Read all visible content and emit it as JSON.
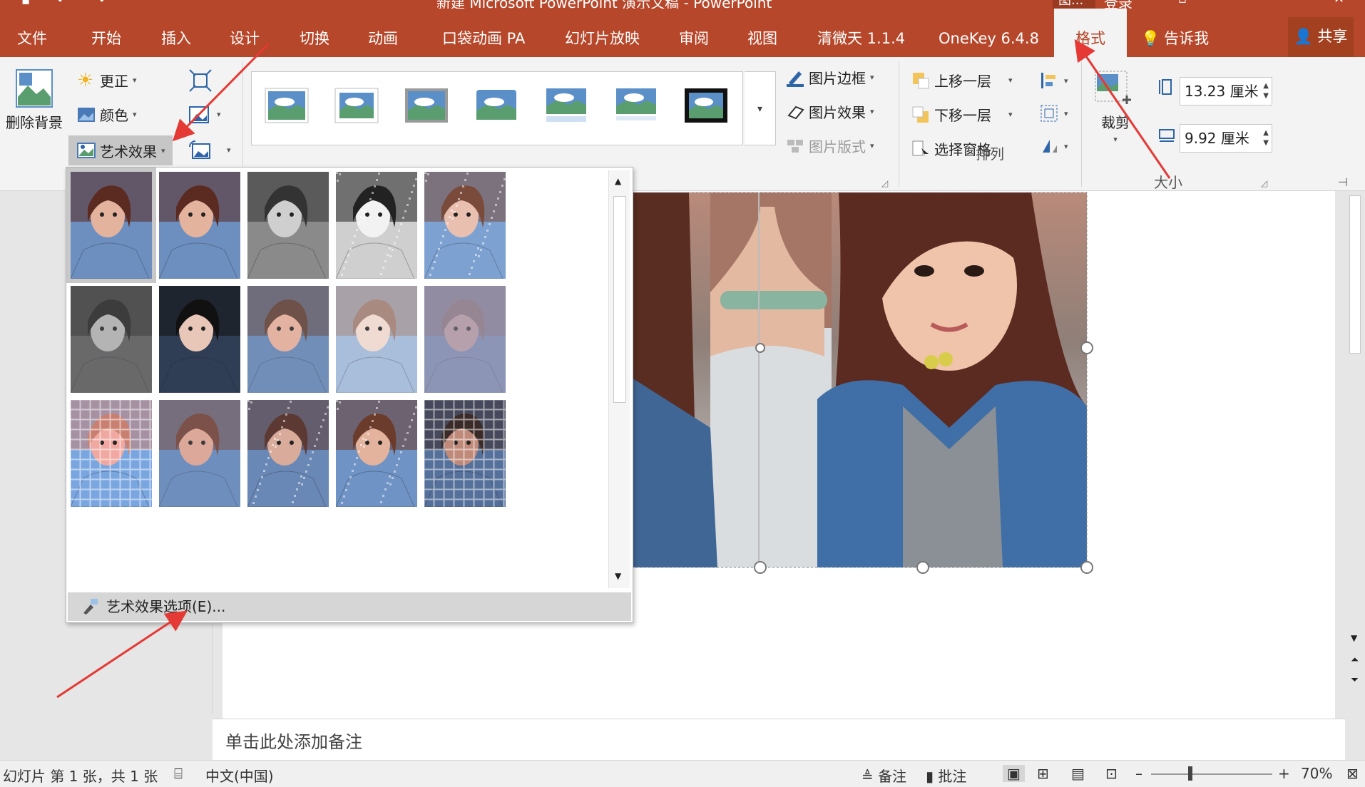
{
  "window": {
    "title": "新建 Microsoft PowerPoint 演示文稿 - PowerPoint",
    "context_tab_group": "图...",
    "login": "登录"
  },
  "tabs": [
    {
      "label": "文件"
    },
    {
      "label": "开始"
    },
    {
      "label": "插入"
    },
    {
      "label": "设计"
    },
    {
      "label": "切换"
    },
    {
      "label": "动画"
    },
    {
      "label": "口袋动画 PA"
    },
    {
      "label": "幻灯片放映"
    },
    {
      "label": "审阅"
    },
    {
      "label": "视图"
    },
    {
      "label": "清微天 1.1.4"
    },
    {
      "label": "OneKey 6.4.8"
    },
    {
      "label": "格式"
    }
  ],
  "tell_me": "告诉我",
  "share": "共享",
  "ribbon": {
    "remove_bg": "删除背景",
    "corrections": "更正",
    "color": "颜色",
    "art_effects": "艺术效果",
    "picture_border": "图片边框",
    "picture_effects": "图片效果",
    "picture_layout": "图片版式",
    "bring_forward": "上移一层",
    "send_backward": "下移一层",
    "selection_pane": "选择窗格",
    "arrange_label": "排列",
    "crop": "裁剪",
    "size_label": "大小",
    "height_value": "13.23 厘米",
    "width_value": "9.92 厘米"
  },
  "art_panel": {
    "options_label": "艺术效果选项(E)..."
  },
  "notes": {
    "placeholder": "单击此处添加备注"
  },
  "status": {
    "slide_info": "幻灯片 第 1 张，共 1 张",
    "language": "中文(中国)",
    "notes_btn": "备注",
    "comments_btn": "批注",
    "zoom": "70%"
  },
  "colors": {
    "accent": "#b7472a",
    "arrow": "#e53935"
  }
}
